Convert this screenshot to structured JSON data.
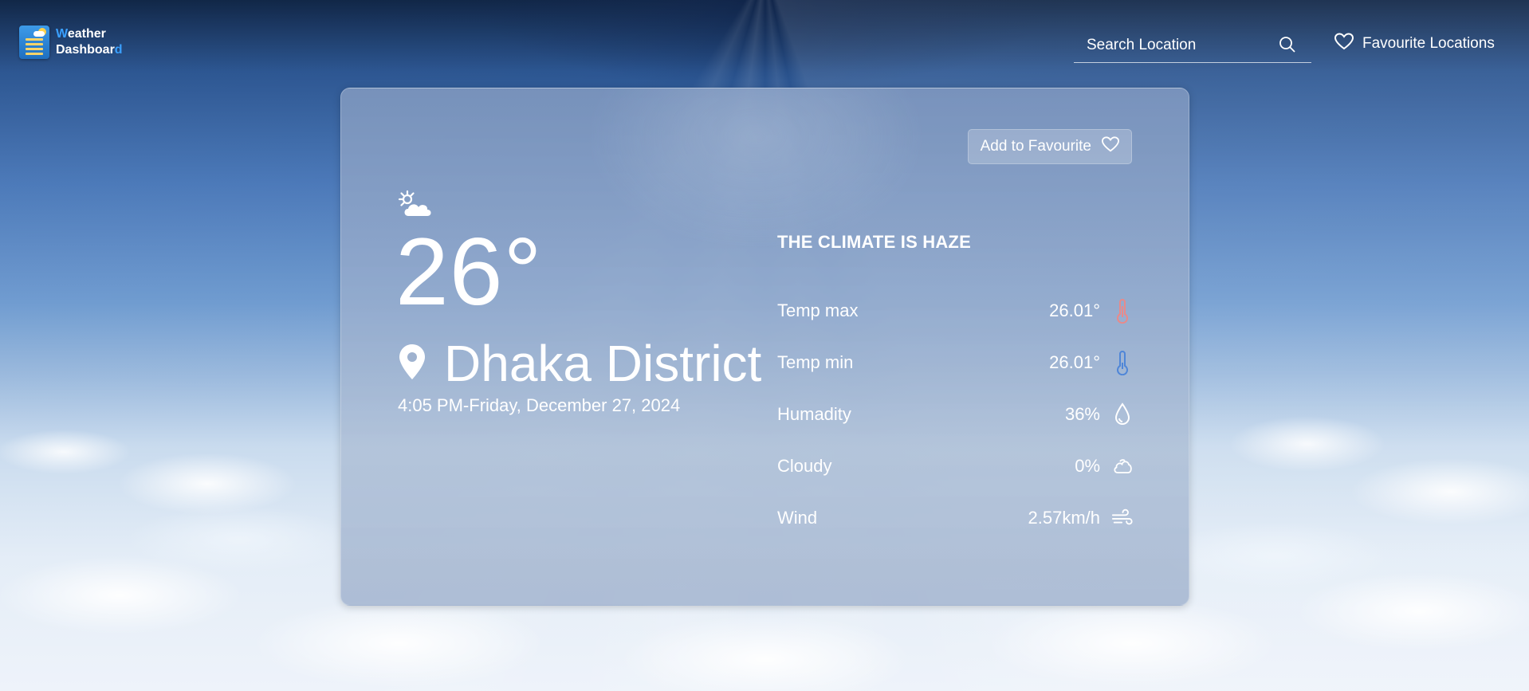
{
  "app": {
    "logo_text_line1_a": "W",
    "logo_text_line1_b": "eather",
    "logo_text_line2_a": "Dashboar",
    "logo_text_line2_b": "d"
  },
  "header": {
    "search_placeholder": "Search Location",
    "favourites_label": "Favourite Locations"
  },
  "card": {
    "add_favourite_label": "Add to Favourite",
    "weather_icon": "partly-cloudy-icon",
    "temperature": "26°",
    "location": "Dhaka District",
    "datetime": "4:05 PM-Friday, December 27, 2024",
    "climate": "THE CLIMATE IS HAZE",
    "stats": [
      {
        "label": "Temp max",
        "value": "26.01°",
        "icon": "thermometer-hot-icon",
        "color": "#e98a8a"
      },
      {
        "label": "Temp min",
        "value": "26.01°",
        "icon": "thermometer-cold-icon",
        "color": "#4f86d8"
      },
      {
        "label": "Humadity",
        "value": "36%",
        "icon": "droplet-icon"
      },
      {
        "label": "Cloudy",
        "value": "0%",
        "icon": "cloud-icon"
      },
      {
        "label": "Wind",
        "value": "2.57km/h",
        "icon": "wind-icon"
      }
    ]
  }
}
